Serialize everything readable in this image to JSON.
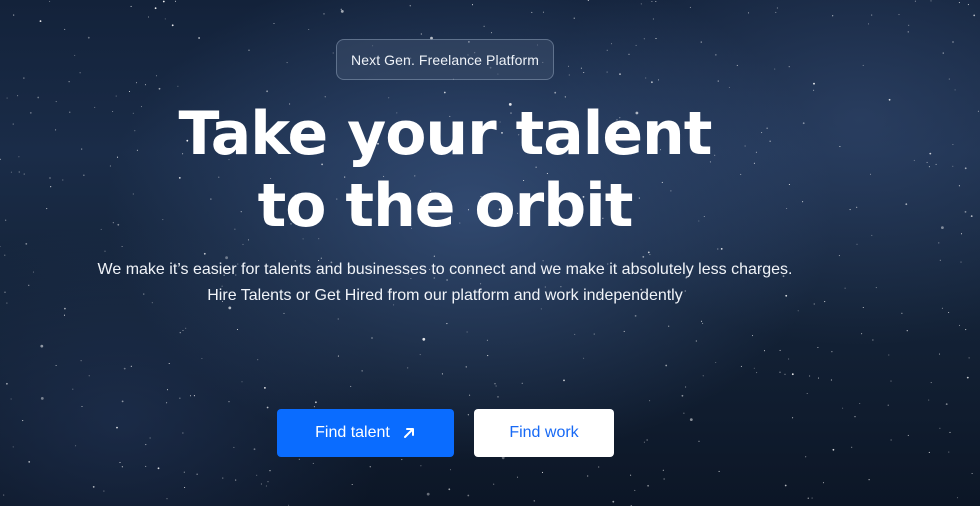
{
  "hero": {
    "badge": "Next Gen. Freelance Platform",
    "headline_line1": "Take your talent",
    "headline_line2": "to the orbit",
    "subtitle_line1": "We make it’s easier for talents and businesses to connect and we make it absolutely less charges.",
    "subtitle_line2": "Hire Talents or Get Hired from our platform and work independently"
  },
  "buttons": {
    "find_talent_label": "Find talent",
    "find_talent_icon": "arrow-up-right-icon",
    "find_work_label": "Find work"
  },
  "colors": {
    "primary": "#0a6cff",
    "secondary_text": "#1769f5",
    "background": "#13223a"
  }
}
